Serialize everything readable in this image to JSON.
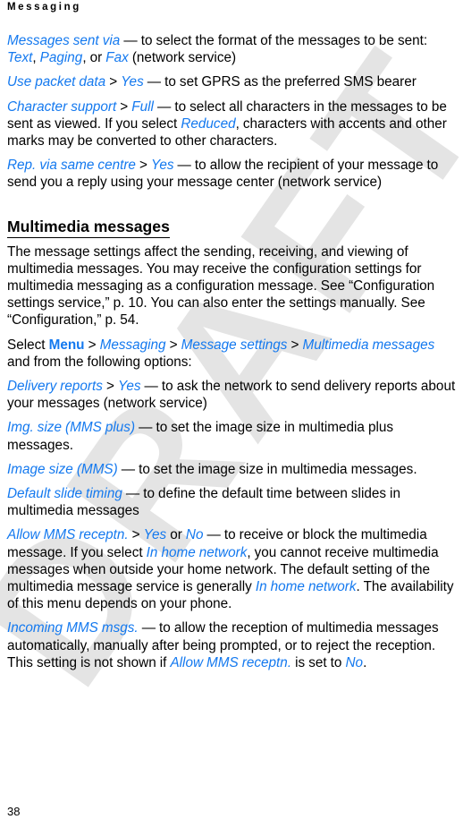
{
  "page": {
    "running_head": "Messaging",
    "folio": "38",
    "watermark": "DRAFT",
    "colors": {
      "ui_term": "#1479ef",
      "body_text": "#000000",
      "watermark": "#e4e4e4",
      "background": "#ffffff"
    }
  },
  "paragraphs": {
    "messages_sent_via": {
      "term": "Messages sent via",
      "dash": " — to select the format of the messages to be sent: ",
      "opt1": "Text",
      "c1": ", ",
      "opt2": "Paging",
      "c2": ", or ",
      "opt3": "Fax",
      "tail": " (network service)"
    },
    "use_packet_data": {
      "term": "Use packet data",
      "gt": " > ",
      "value": "Yes",
      "tail": " — to set GPRS as the preferred SMS bearer"
    },
    "character_support": {
      "term": "Character support",
      "gt": " > ",
      "value": "Full",
      "mid": " — to select all characters in the messages to be sent as viewed. If you select ",
      "value2": "Reduced",
      "tail": ", characters with accents and other marks may be converted to other characters."
    },
    "rep_via_same_centre": {
      "term": "Rep. via same centre",
      "gt": " > ",
      "value": "Yes",
      "tail": " — to allow the recipient of your message to send you a reply using your message center (network service)"
    },
    "mm_intro": {
      "text": "The message settings affect the sending, receiving, and viewing of multimedia messages. You may receive the configuration settings for multimedia messaging as a configuration message. See “Configuration settings service,” p. 10. You can also enter the settings manually. See “Configuration,” p. 54."
    },
    "select_path": {
      "lead": "Select ",
      "menu": "Menu",
      "gt1": " > ",
      "crumb1": "Messaging",
      "gt2": " > ",
      "crumb2": "Message settings",
      "gt3": " > ",
      "crumb3": "Multimedia messages",
      "tail": " and from the following options:"
    },
    "delivery_reports": {
      "term": "Delivery reports",
      "gt": " > ",
      "value": "Yes",
      "tail": " — to ask the network to send delivery reports about your messages (network service)"
    },
    "img_size_mms_plus": {
      "term": "Img. size (MMS plus)",
      "tail": " — to set the image size in multimedia plus messages."
    },
    "image_size_mms": {
      "term": "Image size (MMS)",
      "tail": " — to set the image size in multimedia messages."
    },
    "default_slide_timing": {
      "term": "Default slide timing",
      "tail": " — to define the default time between slides in multimedia messages"
    },
    "allow_mms_receptn": {
      "term": "Allow MMS receptn.",
      "gt": " > ",
      "value1": "Yes",
      "or": " or ",
      "value2": "No",
      "mid": " — to receive or block the multimedia message. If you select ",
      "value3": "In home network",
      "mid2": ", you cannot receive multimedia messages when outside your home network. The default setting of the multimedia message service is generally ",
      "value4": "In home network",
      "tail": ". The availability of this menu depends on your phone."
    },
    "incoming_mms_msgs": {
      "term": "Incoming MMS msgs.",
      "mid": " — to allow the reception of multimedia messages automatically, manually after being prompted, or to reject the reception. This setting is not shown if ",
      "value": "Allow MMS receptn.",
      "mid2": " is set to ",
      "value2": "No",
      "tail": "."
    }
  },
  "headings": {
    "multimedia_messages": "Multimedia messages"
  }
}
